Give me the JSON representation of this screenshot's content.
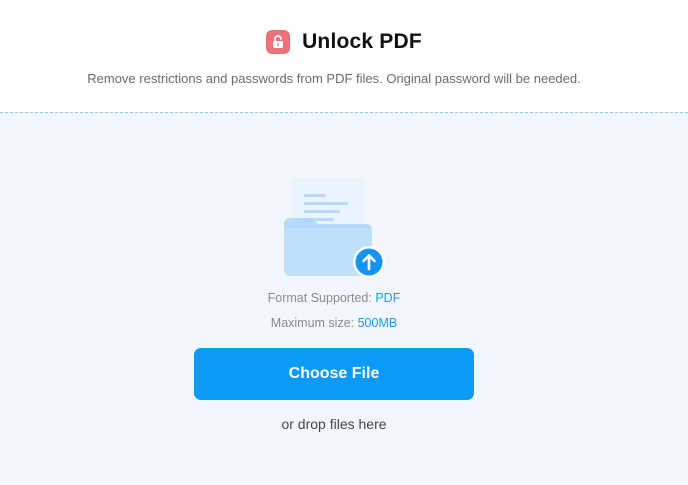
{
  "header": {
    "title": "Unlock PDF",
    "icon": "unlock-icon",
    "subtitle": "Remove restrictions and passwords from PDF files. Original password will be needed."
  },
  "upload": {
    "illustration_icon": "folder-upload-icon",
    "format_label": "Format Supported:",
    "format_value": "PDF",
    "size_label": "Maximum size:",
    "size_value": "500MB",
    "choose_button_label": "Choose File",
    "drop_hint": "or drop files here"
  },
  "colors": {
    "accent": "#1a9bf0",
    "button": "#0b9bf7",
    "icon_badge": "#f0707a",
    "dropzone_bg": "#f2f7fd",
    "dropzone_border": "#8fcbe8"
  }
}
